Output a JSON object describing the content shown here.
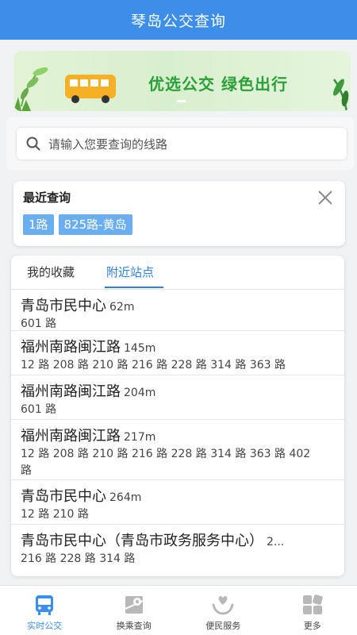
{
  "header": {
    "title": "琴岛公交查询"
  },
  "banner": {
    "text": "优选公交 绿色出行"
  },
  "search": {
    "placeholder": "请输入您要查询的线路"
  },
  "recent": {
    "title": "最近查询",
    "chips": [
      "1路",
      "825路-黄岛"
    ]
  },
  "tabs": [
    {
      "label": "我的收藏",
      "active": false
    },
    {
      "label": "附近站点",
      "active": true
    }
  ],
  "stations": [
    {
      "name": "青岛市民中心",
      "distance": "62m",
      "lines": "601 路"
    },
    {
      "name": "福州南路闽江路",
      "distance": "145m",
      "lines": "12 路 208 路 210 路 216 路 228 路 314 路 363 路"
    },
    {
      "name": "福州南路闽江路",
      "distance": "204m",
      "lines": "601 路"
    },
    {
      "name": "福州南路闽江路",
      "distance": "217m",
      "lines": "12 路 208 路 210 路 216 路 228 路 314 路 363 路 402 路"
    },
    {
      "name": "青岛市民中心",
      "distance": "264m",
      "lines": "12 路 210 路"
    },
    {
      "name": "青岛市民中心（青岛市政务服务中心）",
      "distance": "2...",
      "lines": "216 路 228 路 314 路"
    }
  ],
  "nav": [
    {
      "label": "实时公交",
      "icon": "bus-icon",
      "active": true
    },
    {
      "label": "换乘查询",
      "icon": "map-pin-icon",
      "active": false
    },
    {
      "label": "便民服务",
      "icon": "heart-hands-icon",
      "active": false
    },
    {
      "label": "更多",
      "icon": "grid-icon",
      "active": false
    }
  ],
  "colors": {
    "primary": "#3d8ee8",
    "chip": "#6aaef0",
    "banner_text": "#2c9f3b"
  }
}
